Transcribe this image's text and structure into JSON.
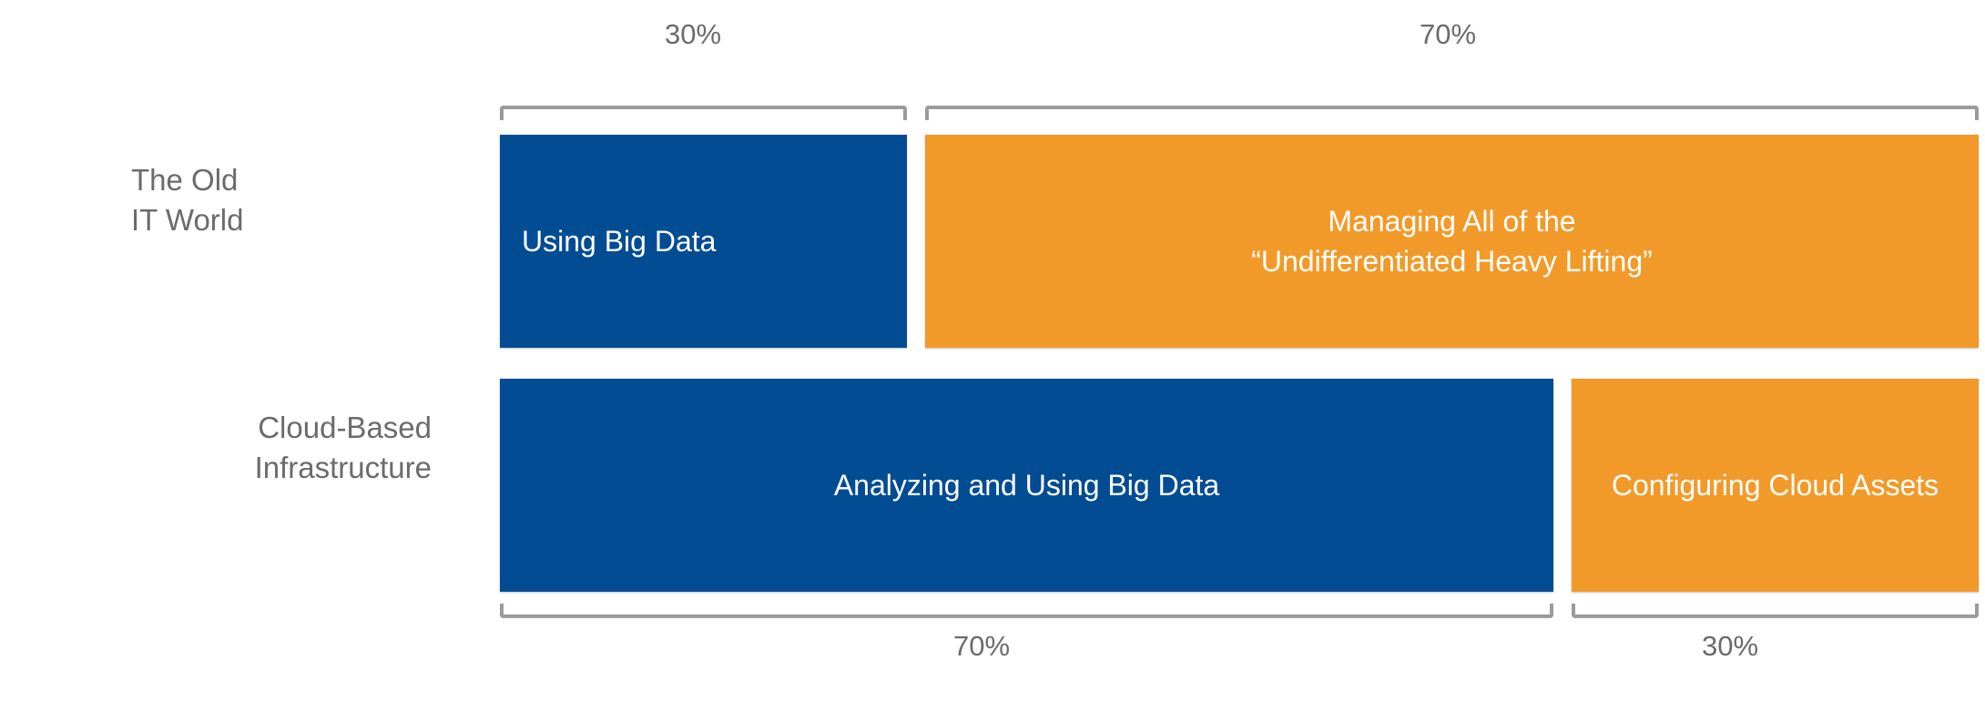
{
  "colors": {
    "blue": "#024c93",
    "orange": "#f19a2a",
    "bracket": "#9b9b9b",
    "label": "#6b6b6b"
  },
  "rows": [
    {
      "label": "The Old\nIT World",
      "segments": [
        {
          "text": "Using Big Data",
          "percent": "30%",
          "color": "blue"
        },
        {
          "text": "Managing All of the\n“Undifferentiated Heavy Lifting”",
          "percent": "70%",
          "color": "orange"
        }
      ]
    },
    {
      "label": "Cloud-Based\nInfrastructure",
      "segments": [
        {
          "text": "Analyzing and Using Big Data",
          "percent": "70%",
          "color": "blue"
        },
        {
          "text": "Configuring Cloud Assets",
          "percent": "30%",
          "color": "orange"
        }
      ]
    }
  ]
}
